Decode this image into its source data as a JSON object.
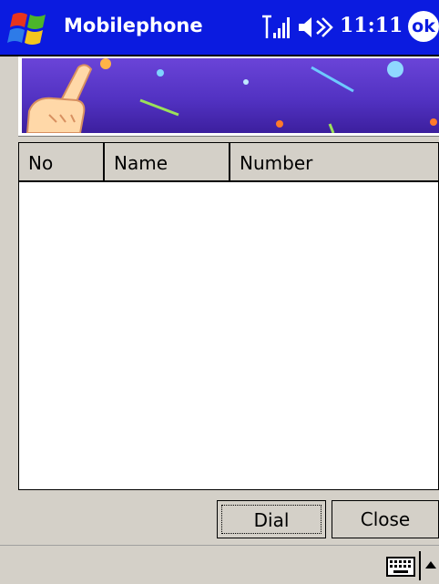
{
  "titlebar": {
    "app_title": "Mobilephone",
    "clock": "11:11",
    "ok_label": "ok"
  },
  "list": {
    "columns": [
      "No",
      "Name",
      "Number"
    ],
    "rows": []
  },
  "buttons": {
    "dial": "Dial",
    "close": "Close"
  },
  "colors": {
    "titlebar": "#0b1be0",
    "banner": "#5232c2",
    "chrome": "#d4d0c8"
  },
  "icons": [
    "windows-start-icon",
    "signal-icon",
    "volume-icon",
    "keyboard-icon",
    "sip-arrow-icon"
  ]
}
